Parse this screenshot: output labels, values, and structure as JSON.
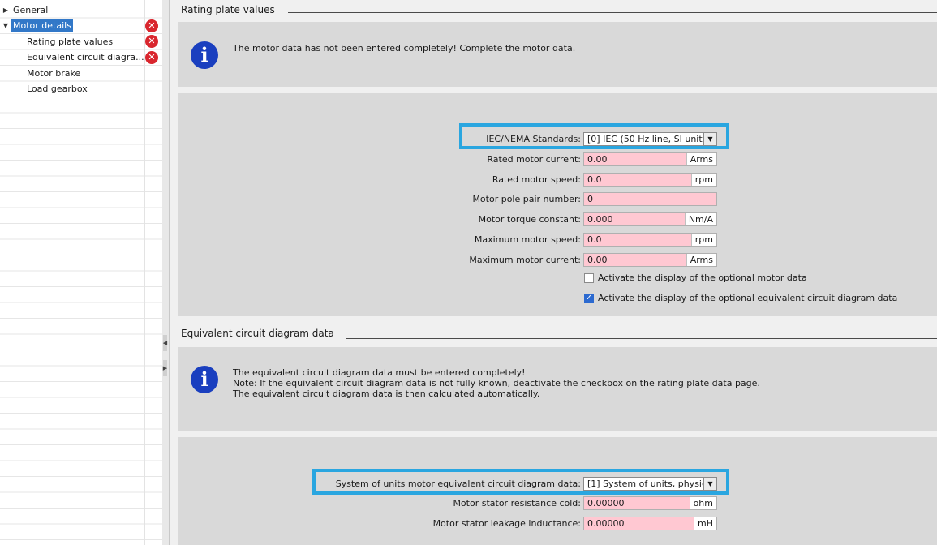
{
  "nav": {
    "items": [
      {
        "label": "General"
      },
      {
        "label": "Motor details"
      },
      {
        "label": "Rating plate values"
      },
      {
        "label": "Equivalent circuit diagra..."
      },
      {
        "label": "Motor brake"
      },
      {
        "label": "Load gearbox"
      }
    ]
  },
  "rating": {
    "title": "Rating plate values",
    "info": "The motor data has not been entered completely! Complete the motor data.",
    "standards_label": "IEC/NEMA Standards:",
    "standards_value": "[0] IEC (50 Hz line, SI units",
    "fields": [
      {
        "label": "Rated motor current:",
        "value": "0.00",
        "unit": "Arms"
      },
      {
        "label": "Rated motor speed:",
        "value": "0.0",
        "unit": "rpm"
      },
      {
        "label": "Motor pole pair number:",
        "value": "0",
        "unit": ""
      },
      {
        "label": "Motor torque constant:",
        "value": "0.000",
        "unit": "Nm/A"
      },
      {
        "label": "Maximum motor speed:",
        "value": "0.0",
        "unit": "rpm"
      },
      {
        "label": "Maximum motor current:",
        "value": "0.00",
        "unit": "Arms"
      }
    ],
    "check_optional_motor": "Activate the display of the optional motor data",
    "check_optional_motor_checked": false,
    "check_optional_ecd": "Activate the display of the optional equivalent circuit diagram data",
    "check_optional_ecd_checked": true
  },
  "ecd": {
    "title": "Equivalent circuit diagram data",
    "info_line1": "The equivalent circuit diagram data must be entered completely!",
    "info_line2": "Note: If the equivalent circuit diagram data is not fully known, deactivate the checkbox on the rating plate data page.",
    "info_line3": "The equivalent circuit diagram data is then calculated automatically.",
    "units_label": "System of units motor equivalent circuit diagram data:",
    "units_value": "[1] System of units, physic",
    "fields": [
      {
        "label": "Motor stator resistance cold:",
        "value": "0.00000",
        "unit": "ohm"
      },
      {
        "label": "Motor stator leakage inductance:",
        "value": "0.00000",
        "unit": "mH"
      }
    ]
  },
  "colors": {
    "highlight": "#2aa6e0",
    "error": "#d9262e",
    "field_bg": "#ffc8d2",
    "info_icon": "#1a3fbf",
    "selection": "#3278c8"
  },
  "icons": {
    "error": "error-icon",
    "info": "info-icon",
    "expand": "triangle-right-icon",
    "collapse": "triangle-down-icon",
    "dropdown": "chevron-down-icon"
  }
}
